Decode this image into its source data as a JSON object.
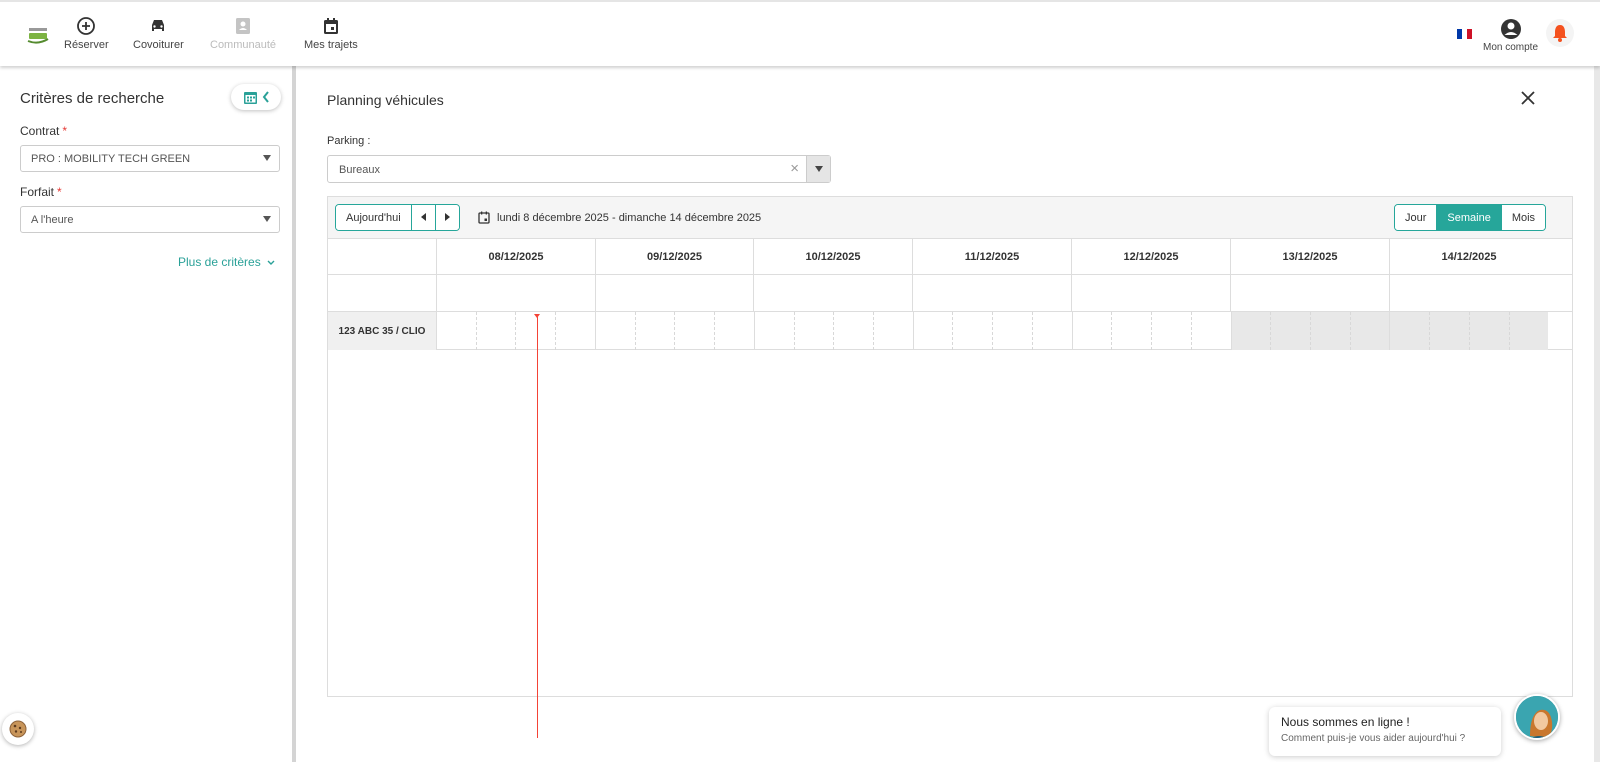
{
  "nav": {
    "items": [
      {
        "label": "Réserver",
        "icon": "plus-circle-icon"
      },
      {
        "label": "Covoiturer",
        "icon": "car-icon"
      },
      {
        "label": "Communauté",
        "icon": "contact-card-icon",
        "disabled": true
      },
      {
        "label": "Mes trajets",
        "icon": "calendar-icon"
      }
    ],
    "account_label": "Mon compte",
    "language": "fr"
  },
  "sidebar": {
    "title": "Critères de recherche",
    "contract": {
      "label": "Contrat",
      "required_mark": "*",
      "value": "PRO : MOBILITY TECH GREEN"
    },
    "plan": {
      "label": "Forfait",
      "required_mark": "*",
      "value": "A l'heure"
    },
    "more_criteria": "Plus de critères"
  },
  "planning": {
    "title": "Planning véhicules",
    "parking_label": "Parking :",
    "parking_value": "Bureaux",
    "clear_symbol": "×",
    "today_button": "Aujourd'hui",
    "date_range": "lundi 8 décembre 2025 - dimanche 14 décembre 2025",
    "views": [
      "Jour",
      "Semaine",
      "Mois"
    ],
    "active_view": "Semaine",
    "days": [
      "08/12/2025",
      "09/12/2025",
      "10/12/2025",
      "11/12/2025",
      "12/12/2025",
      "13/12/2025",
      "14/12/2025"
    ],
    "resources": [
      "123 ABC 35 / CLIO"
    ]
  },
  "chat": {
    "title": "Nous sommes en ligne !",
    "subtitle": "Comment puis-je vous aider aujourd'hui ?"
  },
  "colors": {
    "accent": "#26a69a",
    "now_line": "#f44336",
    "required": "#e53935"
  }
}
